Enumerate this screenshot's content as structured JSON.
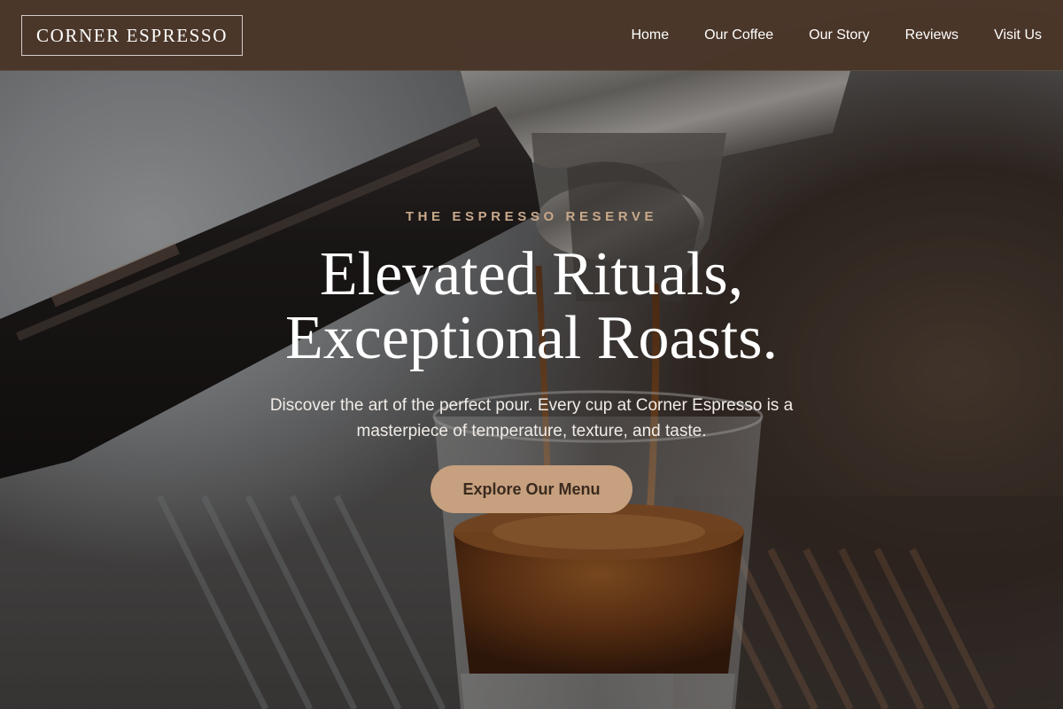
{
  "brand": {
    "name": "CORNER ESPRESSO"
  },
  "nav": {
    "items": [
      {
        "label": "Home"
      },
      {
        "label": "Our Coffee"
      },
      {
        "label": "Our Story"
      },
      {
        "label": "Reviews"
      },
      {
        "label": "Visit Us"
      }
    ]
  },
  "hero": {
    "eyebrow": "THE ESPRESSO RESERVE",
    "headline_line1": "Elevated Rituals,",
    "headline_line2": "Exceptional Roasts.",
    "description": "Discover the art of the perfect pour. Every cup at Corner Espresso is a masterpiece of temperature, texture, and taste.",
    "cta_label": "Explore Our Menu",
    "background_image": "espresso machine pouring into shot glass"
  },
  "colors": {
    "header_bg": "#4a3628",
    "accent": "#c6a07f",
    "eyebrow": "#c9a98a",
    "cta_text": "#3a2a1e",
    "text_light": "#ffffff"
  }
}
